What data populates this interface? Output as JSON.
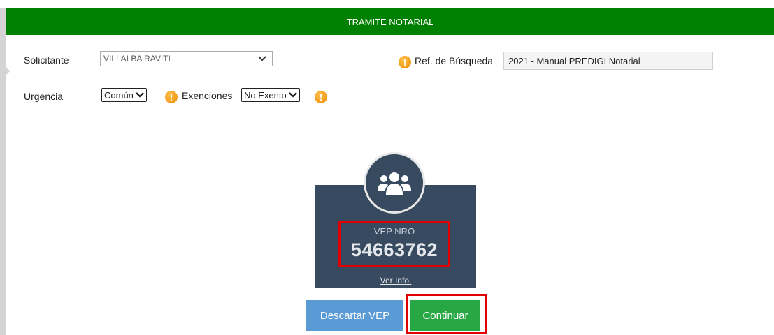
{
  "header": {
    "title": "TRAMITE NOTARIAL"
  },
  "form": {
    "solicitante_label": "Solicitante",
    "solicitante_value": "VILLALBA RAVITI",
    "ref_label": "Ref. de Búsqueda",
    "ref_value": "2021 - Manual PREDIGI Notarial",
    "urgencia_label": "Urgencia",
    "urgencia_value": "Común",
    "exenciones_label": "Exenciones",
    "exenciones_value": "No Exento"
  },
  "vep_card": {
    "icon": "users-icon",
    "label": "VEP NRO",
    "number": "54663762",
    "link": "Ver Info."
  },
  "actions": {
    "discard_label": "Descartar VEP",
    "continue_label": "Continuar"
  },
  "colors": {
    "header_bg": "#008000",
    "card_bg": "#374a60",
    "highlight": "#e00000",
    "discard_bg": "#5b9bd5",
    "continue_bg": "#28a745",
    "warning": "#ee8a00"
  },
  "icons": {
    "warning": "warning-icon",
    "chevron": "chevron-down-icon"
  }
}
